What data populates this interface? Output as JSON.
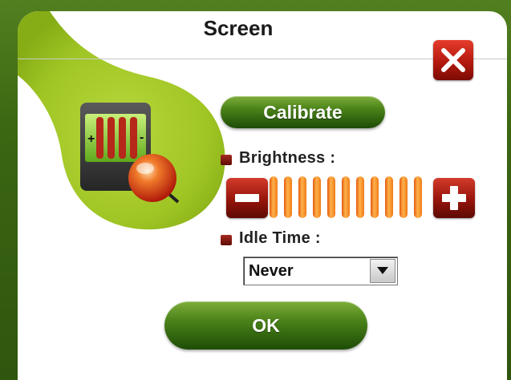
{
  "window": {
    "title": "Screen"
  },
  "buttons": {
    "calibrate": "Calibrate",
    "ok": "OK"
  },
  "brightness": {
    "label": "Brightness :",
    "segments": 11,
    "level": 1.0
  },
  "idle_time": {
    "label": "Idle Time :",
    "selected": "Never"
  },
  "icons": {
    "close": "close-icon",
    "minus": "minus-icon",
    "plus": "plus-icon",
    "app": "screen-settings-icon",
    "dropdown": "chevron-down-icon"
  },
  "colors": {
    "accent_green": "#4a8219",
    "accent_red": "#9c170c",
    "bar_orange": "#f07a18"
  }
}
